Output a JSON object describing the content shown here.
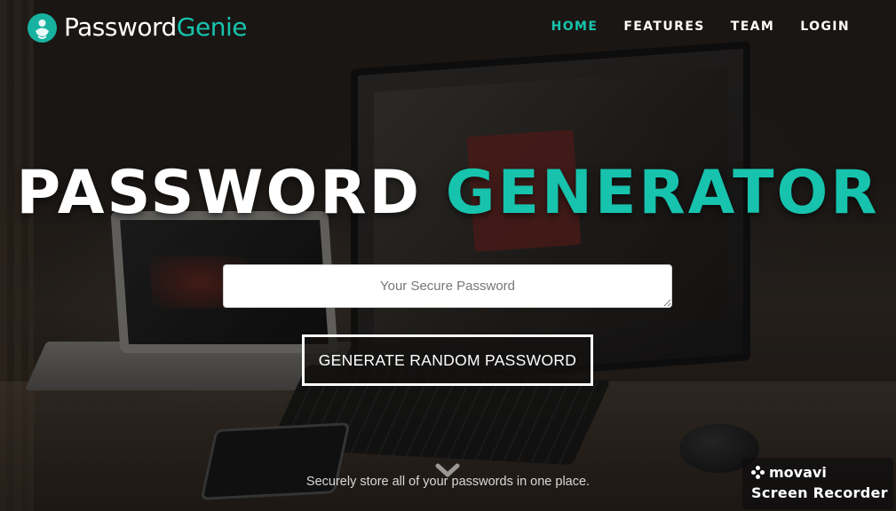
{
  "brand": {
    "name_part1": "Password",
    "name_part2": "Genie",
    "accent_color": "#17c3ad"
  },
  "nav": {
    "items": [
      {
        "label": "HOME",
        "active": true
      },
      {
        "label": "FEATURES",
        "active": false
      },
      {
        "label": "TEAM",
        "active": false
      },
      {
        "label": "LOGIN",
        "active": false
      }
    ]
  },
  "hero": {
    "title_part1": "PASSWORD",
    "title_part2": "GENERATOR",
    "password_field": {
      "value": "",
      "placeholder": "Your Secure Password"
    },
    "generate_button_label": "GENERATE RANDOM PASSWORD",
    "scroll_icon": "chevron-down-icon",
    "tagline": "Securely store all of your passwords in one place."
  },
  "watermark": {
    "line1": "movavi",
    "line2": "Screen Recorder"
  }
}
